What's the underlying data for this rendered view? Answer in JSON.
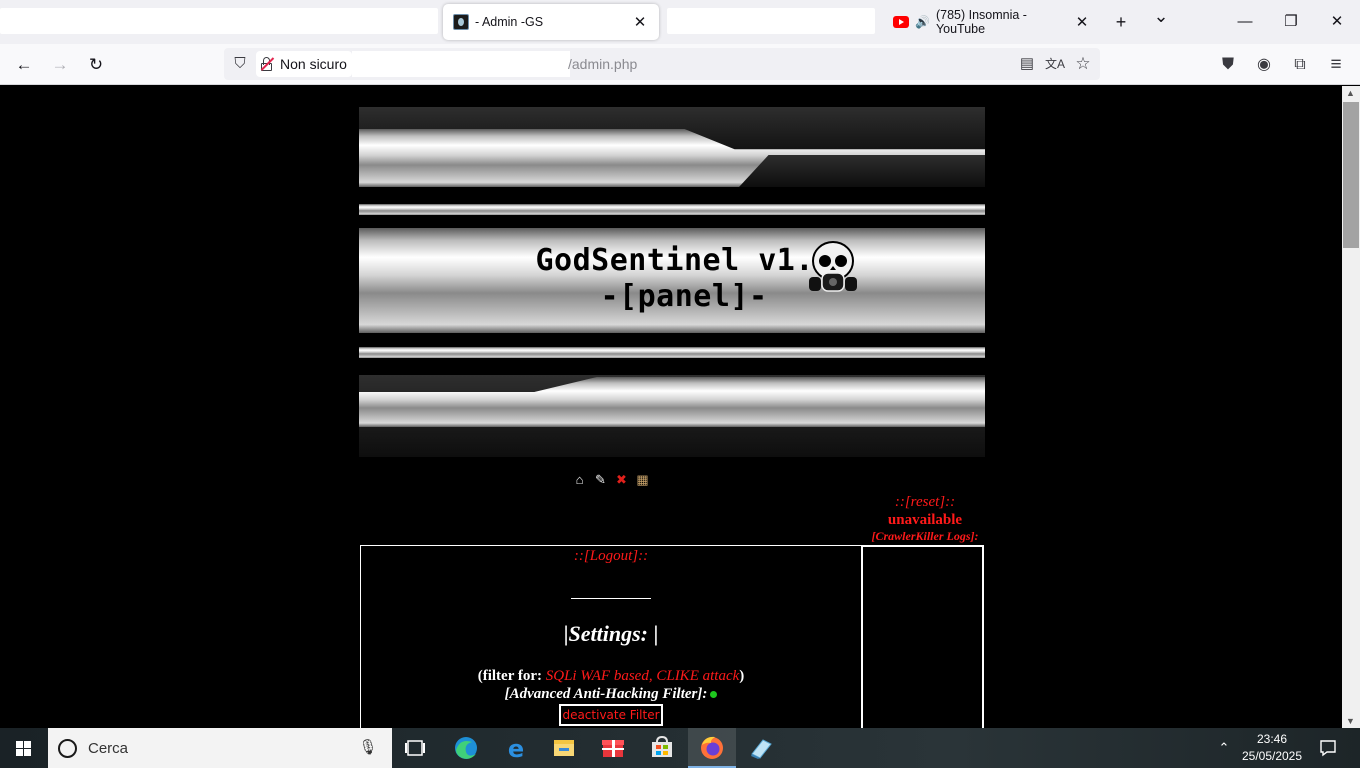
{
  "browser": {
    "tabs": [
      {
        "title": "- Admin -GS",
        "active": true,
        "icon": "site-favicon"
      },
      {
        "title": "(785) Insomnia - YouTube",
        "active": false,
        "icon": "youtube-icon",
        "audio": "speaker-icon"
      }
    ],
    "tab_close_glyph": "✕",
    "new_tab_glyph": "+",
    "tab_list_glyph": "⌄",
    "window_controls": {
      "minimize": "—",
      "restore": "❐",
      "close": "✕"
    },
    "nav": {
      "back": "←",
      "forward": "→",
      "reload": "↻"
    },
    "security_label": "Non sicuro",
    "url": "/admin.php",
    "toolbar_glyphs": {
      "reader": "▤",
      "translate": "文A",
      "bookmark": "☆",
      "pocket": "⛊",
      "account": "◉",
      "extensions": "⧉",
      "menu": "≡"
    }
  },
  "page": {
    "banner": {
      "title_line1": "GodSentinel v1.0",
      "title_line2": "-[panel]-"
    },
    "icon_glyphs": {
      "home": "⌂",
      "edit": "✎",
      "delete": "✖",
      "windows": "▦"
    },
    "right_panel": {
      "reset": "::[reset]::",
      "status": "unavailable",
      "logs_title": "[CrawlerKiller Logs]:"
    },
    "main": {
      "logout": "::[Logout]::",
      "settings_title": "Settings:",
      "filter_open": "(filter for: ",
      "filter_types": "SQLi WAF based, CLIKE attack",
      "filter_close": ")",
      "advanced_label": "[Advanced Anti-Hacking Filter]:",
      "deactivate_button": "deactivate Filter"
    },
    "colors": {
      "accent_red": "#ff1a1a",
      "status_green": "#1ec81e",
      "background": "#000000"
    }
  },
  "taskbar": {
    "search_placeholder": "Cerca",
    "apps": [
      "task-view-icon",
      "edge-icon",
      "edge-legacy-icon",
      "file-explorer-icon",
      "gift-icon",
      "store-icon",
      "firefox-icon",
      "notepad-icon"
    ],
    "tray_up": "⌃",
    "time": "23:46",
    "date": "25/05/2025",
    "notification_glyph": "🗨"
  }
}
